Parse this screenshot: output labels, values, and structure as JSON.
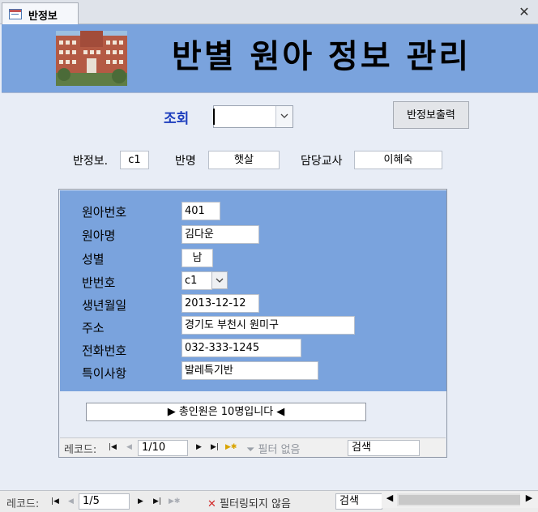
{
  "tab": {
    "title": "반정보"
  },
  "header": {
    "title": "반별 원아 정보 관리"
  },
  "search": {
    "label": "조회",
    "value": ""
  },
  "buttons": {
    "print": "반정보출력"
  },
  "class_info": {
    "class_no_label": "반정보.",
    "class_no_value": "c1",
    "class_name_label": "반명",
    "class_name_value": "햇살",
    "teacher_label": "담당교사",
    "teacher_value": "이혜숙"
  },
  "child": {
    "fields": [
      {
        "label": "원아번호",
        "value": "401"
      },
      {
        "label": "원아명",
        "value": "김다운"
      },
      {
        "label": "성별",
        "value": "남"
      },
      {
        "label": "반번호",
        "value": "c1"
      },
      {
        "label": "생년월일",
        "value": "2013-12-12"
      },
      {
        "label": "주소",
        "value": "경기도 부천시 원미구"
      },
      {
        "label": "전화번호",
        "value": "032-333-1245"
      },
      {
        "label": "특이사항",
        "value": "발레특기반"
      }
    ]
  },
  "summary": {
    "total_text": "▶ 총인원은 10명입니다 ◀"
  },
  "sub_nav": {
    "record_label": "레코드:",
    "position": "1/10",
    "filter_text": "필터 없음",
    "search_placeholder": "검색"
  },
  "main_nav": {
    "record_label": "레코드:",
    "position": "1/5",
    "filter_text": "필터링되지 않음",
    "search_placeholder": "검색"
  },
  "colors": {
    "header_bg": "#7aa3dd",
    "search_label": "#1c3dbd",
    "filter_icon_red": "#d22b2b"
  },
  "icons": {
    "first": "first-record-icon",
    "prev": "previous-record-icon",
    "next": "next-record-icon",
    "last": "last-record-icon",
    "new": "new-record-icon",
    "filter": "filter-icon",
    "close": "close-icon",
    "form": "form-icon"
  }
}
